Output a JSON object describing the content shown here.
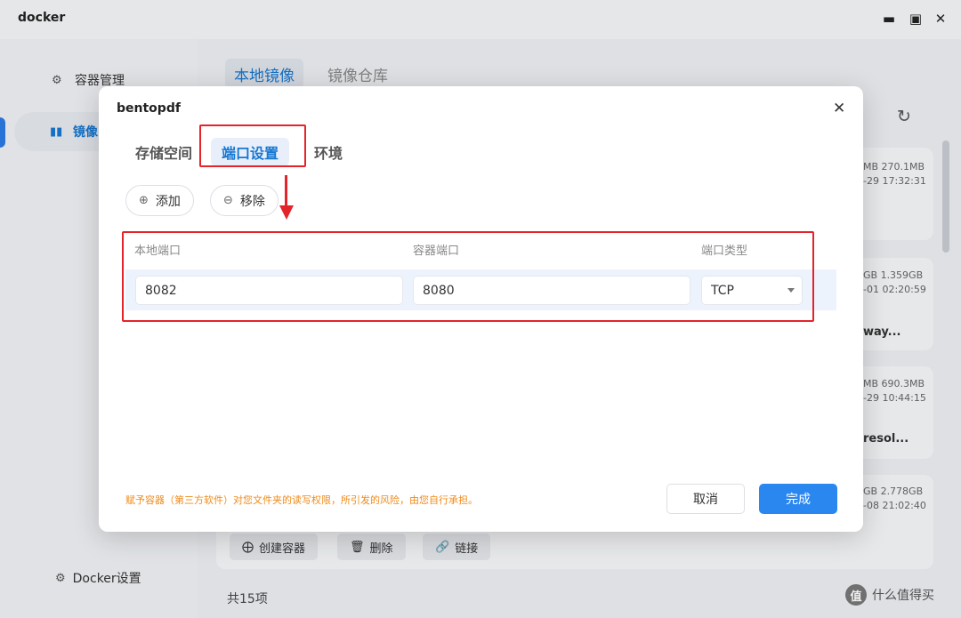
{
  "window": {
    "title": "docker",
    "controls": [
      "minimize-icon",
      "maximize-icon",
      "close-icon"
    ]
  },
  "sidebar": {
    "items": [
      {
        "label": "容器管理",
        "icon": "container-icon"
      },
      {
        "label": "镜像",
        "icon": "image-icon",
        "active": true
      }
    ],
    "settings_label": "Docker设置"
  },
  "main": {
    "tabs": [
      {
        "label": "本地镜像",
        "active": true
      },
      {
        "label": "镜像仓库",
        "active": false
      }
    ],
    "cards": [
      {
        "size": "MB 270.1MB",
        "date": "-29 17:32:31",
        "name": ""
      },
      {
        "size": "GB 1.359GB",
        "date": "-01 02:20:59",
        "name": "way..."
      },
      {
        "size": "MB 690.3MB",
        "date": "-29 10:44:15",
        "name": "resol..."
      },
      {
        "size": "GB 2.778GB",
        "date": "-08 21:02:40",
        "name": ""
      }
    ],
    "card_actions": {
      "create": "创建容器",
      "delete": "删除",
      "link": "链接"
    },
    "total": "共15项"
  },
  "dialog": {
    "title": "bentopdf",
    "tabs": [
      {
        "label": "存储空间",
        "active": false
      },
      {
        "label": "端口设置",
        "active": true
      },
      {
        "label": "环境",
        "active": false
      }
    ],
    "add_label": "添加",
    "remove_label": "移除",
    "table": {
      "headers": [
        "本地端口",
        "容器端口",
        "端口类型"
      ],
      "rows": [
        {
          "local_port": "8082",
          "container_port": "8080",
          "type": "TCP"
        }
      ]
    },
    "warning": "赋予容器（第三方软件）对您文件夹的读写权限，所引发的风险，由您自行承担。",
    "cancel_label": "取消",
    "done_label": "完成"
  },
  "watermark": {
    "logo": "值",
    "text": "什么值得买"
  },
  "colors": {
    "accent": "#1677d2",
    "primary_button": "#2b87f0",
    "annotation_red": "#e3242b",
    "warning": "#ef8b1a"
  }
}
